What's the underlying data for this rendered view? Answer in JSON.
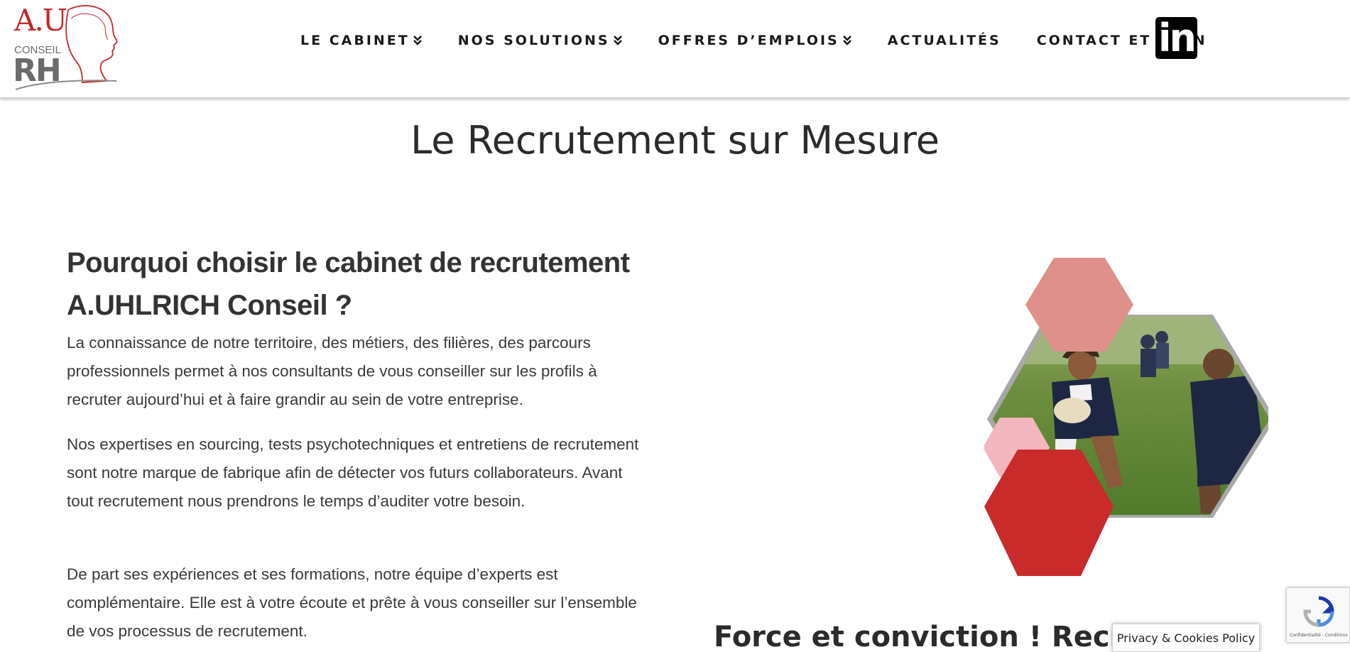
{
  "header": {
    "logo": {
      "name": "au-conseil-rh-logo",
      "top_text": "A.U",
      "mid_text": "CONSEIL",
      "bottom_text": "RH",
      "colors": {
        "red": "#c62828",
        "gray": "#6b6b6b"
      }
    },
    "nav": [
      {
        "label": "LE CABINET",
        "has_dropdown": true
      },
      {
        "label": "NOS SOLUTIONS",
        "has_dropdown": true
      },
      {
        "label": "OFFRES D’EMPLOIS",
        "has_dropdown": true
      },
      {
        "label": "ACTUALITÉS",
        "has_dropdown": false
      },
      {
        "label": "CONTACT ET PLAN",
        "has_dropdown": false
      }
    ],
    "social": {
      "icon": "linkedin-icon",
      "text": "in"
    }
  },
  "main": {
    "page_title": "Le Recrutement sur Mesure",
    "section": {
      "heading": "Pourquoi choisir le cabinet de recrutement A.UHLRICH Conseil ?",
      "paragraphs": [
        "La connaissance de notre territoire, des métiers, des filières, des parcours professionnels permet à nos consultants de vous conseiller sur les profils à recruter aujourd’hui et à faire grandir au sein de votre entreprise.",
        "Nos expertises en sourcing, tests psychotechniques et entretiens de recrutement sont notre marque de fabrique afin de détecter vos futurs collaborateurs. Avant tout recrutement nous prendrons le temps d’auditer votre besoin.",
        "De part ses expériences et ses formations, notre équipe d’experts est complémentaire. Elle est à votre écoute et prête à vous conseiller sur l’ensemble de vos processus de recrutement."
      ]
    },
    "image": {
      "description_icon": "rugby-hexagon-image"
    },
    "subheading": "Force et conviction ! Recruter av"
  },
  "overlays": {
    "privacy_label": "Privacy & Cookies Policy",
    "recaptcha_text": "Confidentialité - Conditions"
  },
  "colors": {
    "hex_salmon": "#e0908b",
    "hex_gray": "#a8a8a8",
    "hex_pink": "#f4b6bf",
    "hex_red": "#c92a2a",
    "text_dark": "#2b2b2b"
  }
}
